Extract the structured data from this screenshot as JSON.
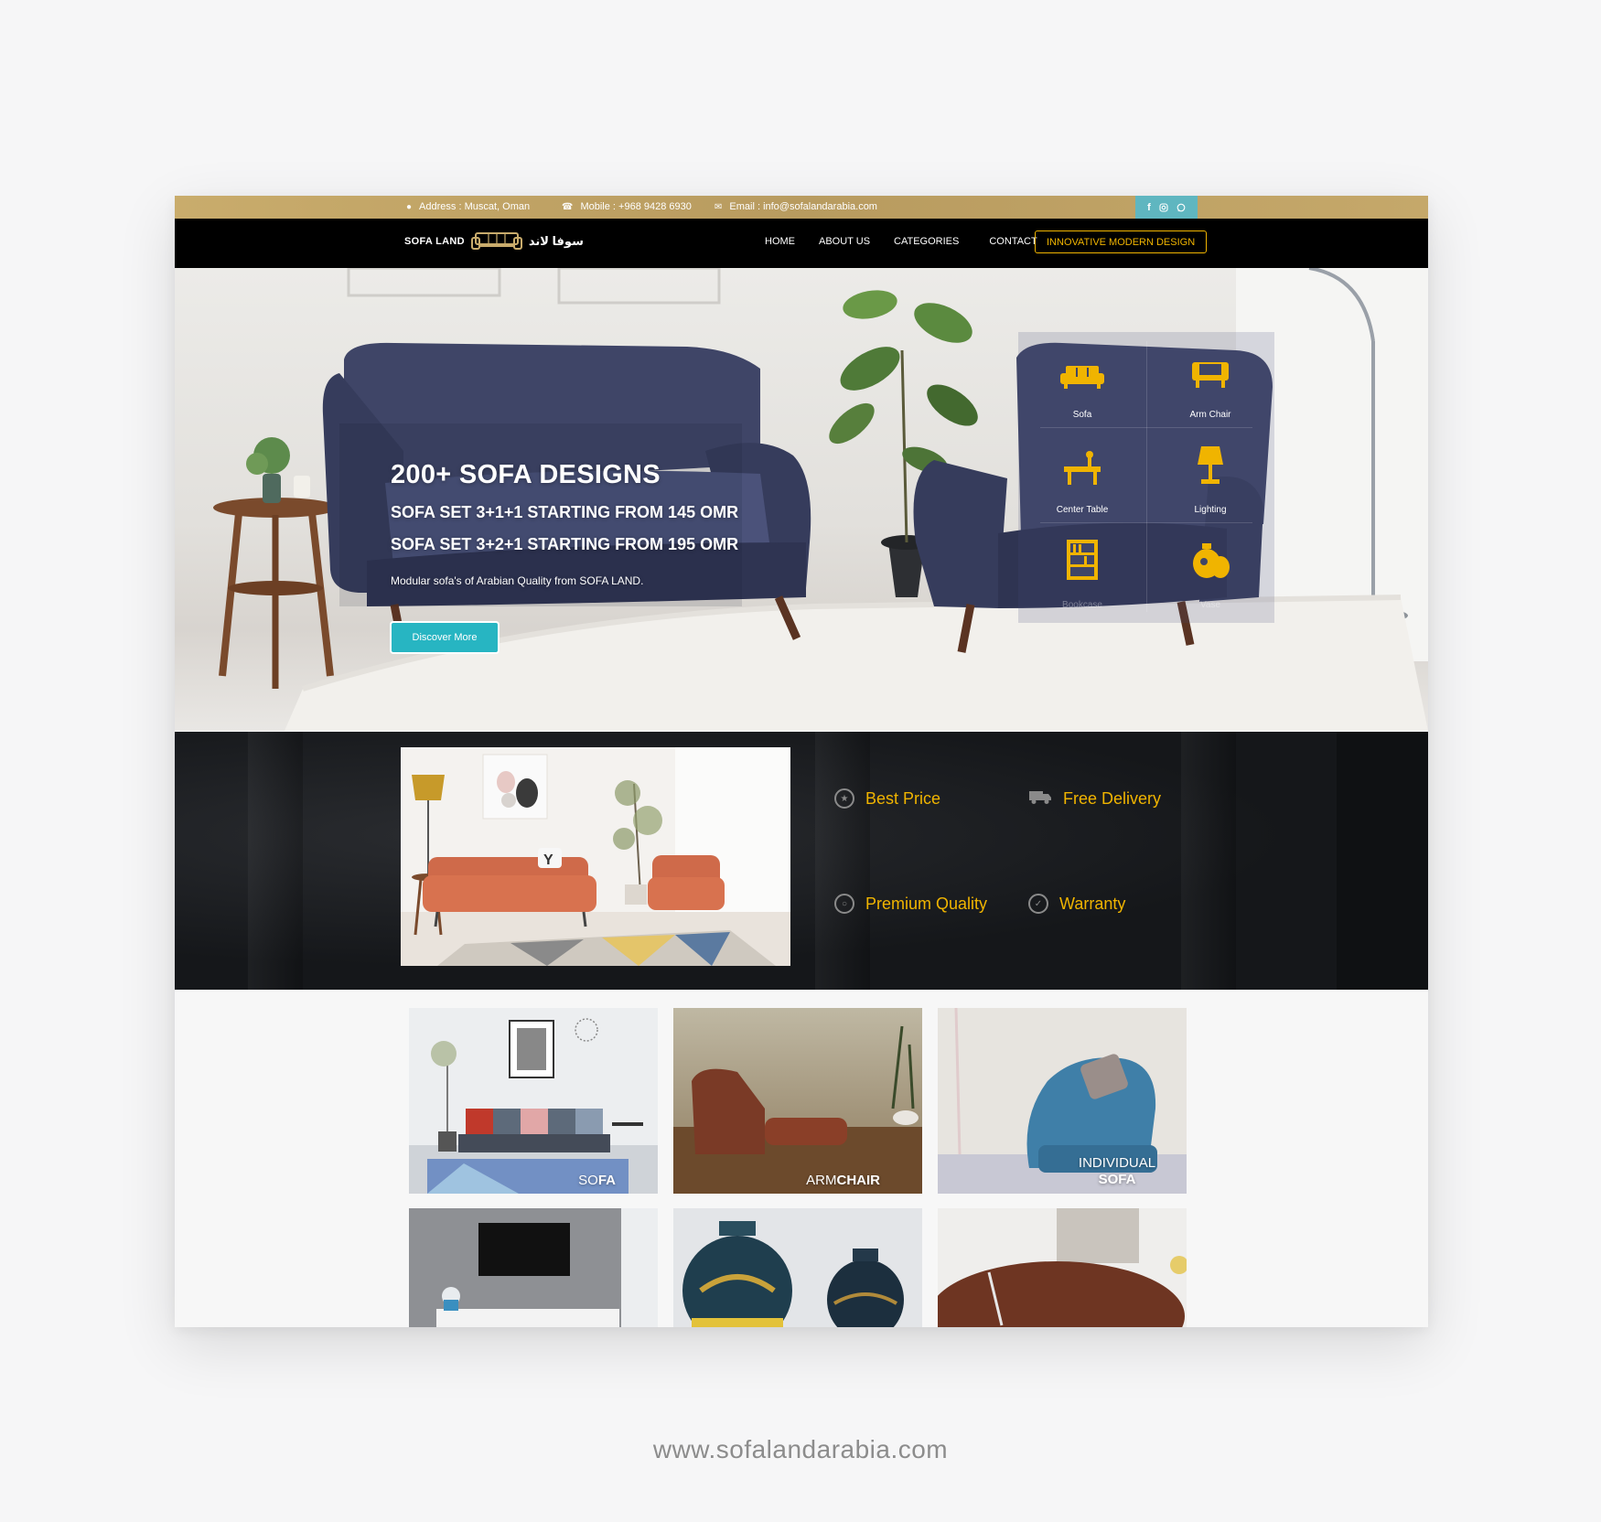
{
  "topbar": {
    "address": "Address : Muscat, Oman",
    "mobile": "Mobile : +968 9428 6930",
    "email": "Email : info@sofalandarabia.com",
    "address_icon": "map-pin-icon",
    "mobile_icon": "phone-icon",
    "email_icon": "envelope-icon",
    "social_icons": [
      "facebook-icon",
      "instagram-icon",
      "whatsapp-icon"
    ]
  },
  "nav": {
    "logo_en": "SOFA LAND",
    "logo_ar": "سوفا لاند",
    "items": [
      "HOME",
      "ABOUT US",
      "CATEGORIES",
      "CONTACT"
    ],
    "cta": "INNOVATIVE MODERN DESIGN"
  },
  "hero": {
    "title": "200+ SOFA DESIGNS",
    "line1": "SOFA SET 3+1+1 STARTING FROM 145 OMR",
    "line2": "SOFA SET 3+2+1 STARTING FROM 195 OMR",
    "description": "Modular sofa's of Arabian Quality from SOFA LAND.",
    "button": "Discover More",
    "categories": [
      "Sofa",
      "Arm Chair",
      "Center Table",
      "Lighting",
      "Bookcase",
      "Vase"
    ]
  },
  "features": {
    "items": [
      "Best Price",
      "Free Delivery",
      "Premium Quality",
      "Warranty"
    ]
  },
  "gallery": {
    "sofa_a": "SO",
    "sofa_b": "FA",
    "armchair_a": "ARM",
    "armchair_b": "CHAIR",
    "individual_a": "INDIVIDUAL",
    "individual_b": "SOFA"
  },
  "footer": {
    "url": "www.sofalandarabia.com"
  },
  "colors": {
    "gold": "#c9ac6c",
    "accent_yellow": "#f0b400",
    "teal": "#27b5c2"
  }
}
